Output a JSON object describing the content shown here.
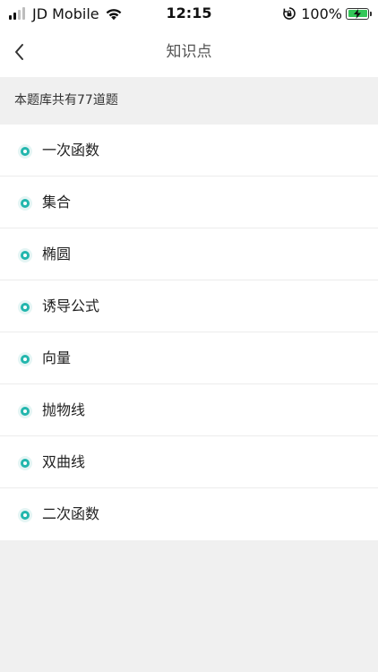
{
  "status_bar": {
    "carrier": "JD Mobile",
    "time": "12:15",
    "battery_percent": "100%",
    "signal_bars": 4,
    "signal_active": 2,
    "battery_level": 1.0,
    "battery_color": "#34c759",
    "icons": [
      "signal-icon",
      "wifi-icon",
      "rotation-lock-icon",
      "battery-charging-icon"
    ]
  },
  "nav": {
    "title": "知识点",
    "back_icon": "chevron-left-icon"
  },
  "info": {
    "text": "本题库共有77道题"
  },
  "topics": [
    {
      "label": "一次函数"
    },
    {
      "label": "集合"
    },
    {
      "label": "椭圆"
    },
    {
      "label": "诱导公式"
    },
    {
      "label": "向量"
    },
    {
      "label": "抛物线"
    },
    {
      "label": "双曲线"
    },
    {
      "label": "二次函数"
    }
  ],
  "colors": {
    "accent": "#22b6ad",
    "accent_light": "#e4f5f4",
    "background": "#f0f0f0",
    "surface": "#ffffff"
  }
}
